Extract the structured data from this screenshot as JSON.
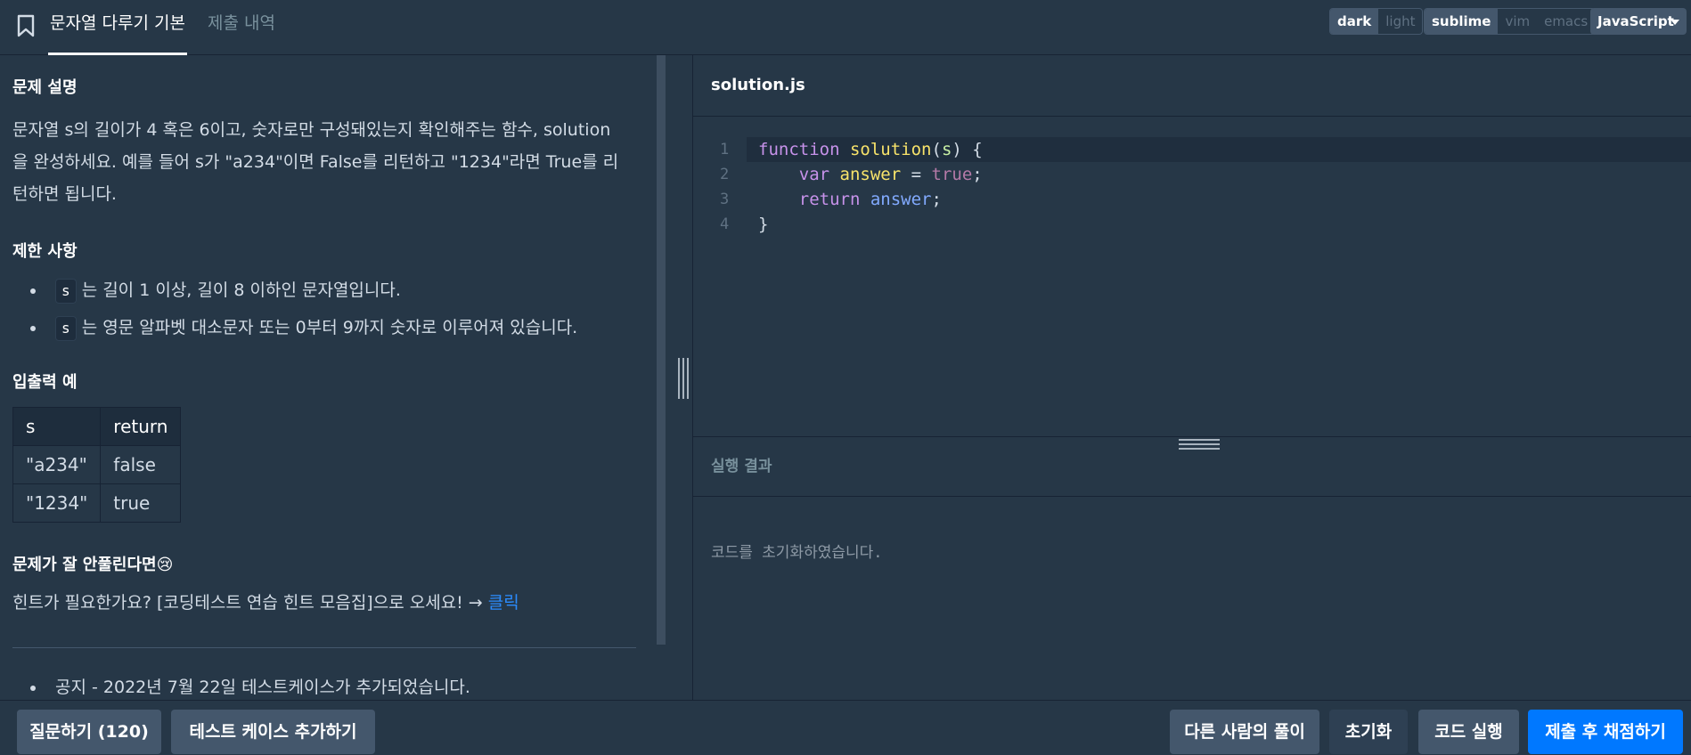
{
  "header": {
    "tabs": [
      {
        "label": "문자열 다루기 기본",
        "active": true
      },
      {
        "label": "제출 내역",
        "active": false
      }
    ],
    "theme": {
      "options": [
        "dark",
        "light"
      ],
      "selected": "dark"
    },
    "keymap": {
      "options": [
        "sublime",
        "vim",
        "emacs"
      ],
      "selected": "sublime"
    },
    "language": "JavaScript"
  },
  "problem": {
    "section_description": "문제 설명",
    "description_lines": [
      "문자열 s의 길이가 4 혹은 6이고, 숫자로만 구성돼있는지 확인해주는 함수, solution",
      "을 완성하세요. 예를 들어 s가 \"a234\"이면 False를 리턴하고 \"1234\"라면 True를 리",
      "턴하면 됩니다."
    ],
    "section_constraints": "제한 사항",
    "constraints": [
      {
        "code": "s",
        "text": "는 길이 1 이상, 길이 8 이하인 문자열입니다."
      },
      {
        "code": "s",
        "text": "는 영문 알파벳 대소문자 또는 0부터 9까지 숫자로 이루어져 있습니다."
      }
    ],
    "section_examples": "입출력 예",
    "examples_table": {
      "headers": [
        "s",
        "return"
      ],
      "rows": [
        [
          "\"a234\"",
          "false"
        ],
        [
          "\"1234\"",
          "true"
        ]
      ]
    },
    "section_help": "문제가 잘 안풀린다면😢",
    "help_text": "힌트가 필요한가요? [코딩테스트 연습 힌트 모음집]으로 오세요! → ",
    "help_link": "클릭",
    "notice": "공지 - 2022년 7월 22일 테스트케이스가 추가되었습니다."
  },
  "editor": {
    "filename": "solution.js",
    "line_numbers": [
      "1",
      "2",
      "3",
      "4"
    ]
  },
  "result": {
    "title": "실행 결과",
    "message": "코드를 초기화하였습니다."
  },
  "footer": {
    "question_button": "질문하기 (120)",
    "add_testcase_button": "테스트 케이스 추가하기",
    "others_solution_button": "다른 사람의 풀이",
    "reset_button": "초기화",
    "run_button": "코드 실행",
    "submit_button": "제출 후 채점하기"
  }
}
